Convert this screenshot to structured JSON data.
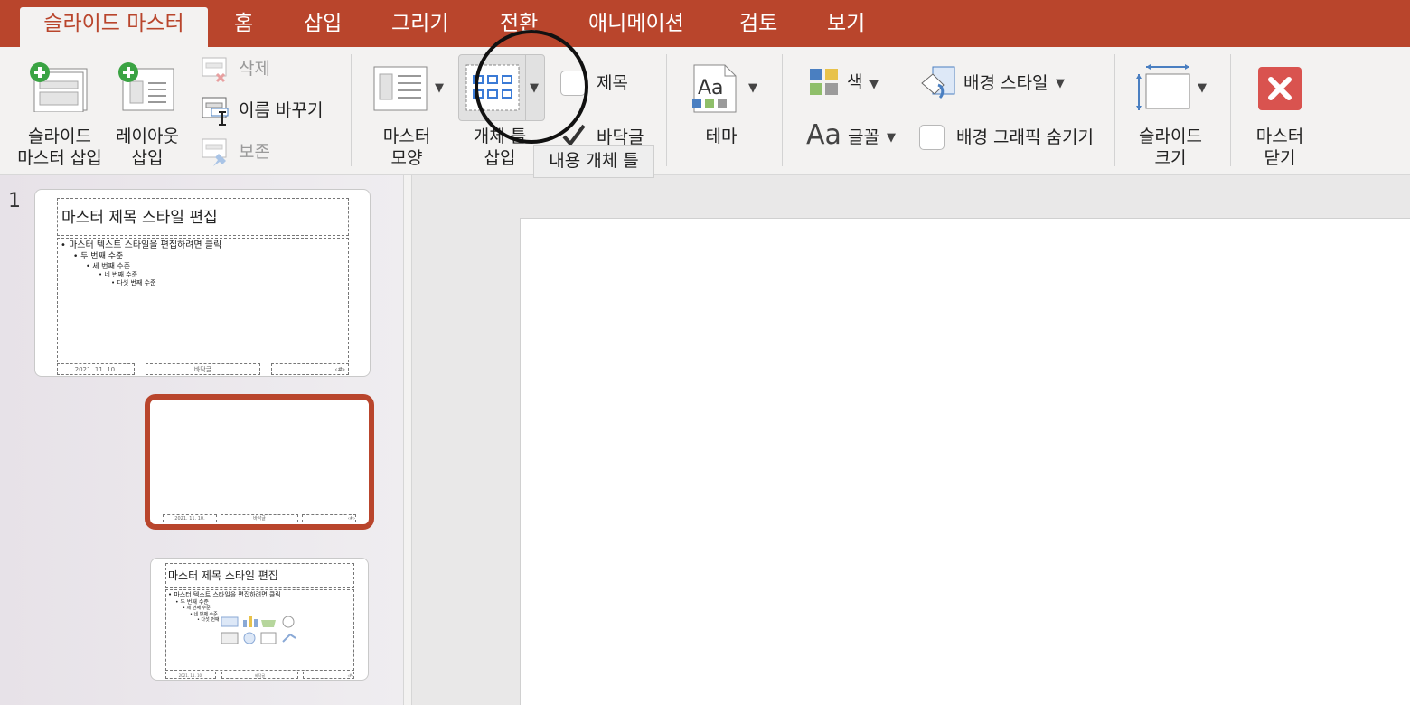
{
  "tabs": [
    "슬라이드 마스터",
    "홈",
    "삽입",
    "그리기",
    "전환",
    "애니메이션",
    "검토",
    "보기"
  ],
  "ribbon": {
    "insert_slide_master": [
      "슬라이드",
      "마스터 삽입"
    ],
    "insert_layout": [
      "레이아웃",
      "삽입"
    ],
    "delete": "삭제",
    "rename": "이름 바꾸기",
    "preserve": "보존",
    "master_layout": [
      "마스터",
      "모양"
    ],
    "insert_placeholder": [
      "개체 틀",
      "삽입"
    ],
    "title_check": "제목",
    "footers_check": "바닥글",
    "tooltip": "내용 개체 틀",
    "theme": "테마",
    "colors": "색",
    "fonts": "글꼴",
    "background_styles": "배경 스타일",
    "hide_background_graphics": "배경 그래픽 숨기기",
    "slide_size": [
      "슬라이드",
      "크기"
    ],
    "close_master": [
      "마스터",
      "닫기"
    ],
    "fonts_icon_text": "Aa",
    "theme_icon_text": "Aa"
  },
  "slides": {
    "number": "1",
    "master_title": "마스터 제목 스타일 편집",
    "body_levels": [
      "• 마스터 텍스트 스타일을 편집하려면 클릭",
      "• 두 번째 수준",
      "• 세 번째 수준",
      "• 네 번째 수준",
      "• 다섯 번째 수준"
    ],
    "footer_date": "2021. 11. 10.",
    "footer_text": "바닥글",
    "footer_num": "‹#›"
  },
  "colors": {
    "accent": "#b9452c",
    "close_red": "#d9534f"
  }
}
